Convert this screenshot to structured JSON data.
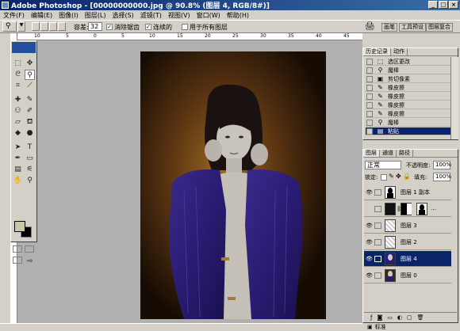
{
  "window": {
    "title": "Adobe Photoshop - [00000000000.jpg @ 90.8% (图层 4, RGB/8#)]"
  },
  "menu": [
    "文件(F)",
    "编辑(E)",
    "图像(I)",
    "图层(L)",
    "选择(S)",
    "滤镜(T)",
    "视图(V)",
    "窗口(W)",
    "帮助(H)"
  ],
  "options": {
    "tolerance_label": "容差:",
    "tolerance_value": "32",
    "antialias_label": "消除锯齿",
    "contiguous_label": "连续的",
    "all_layers_label": "用于所有图层"
  },
  "palette_well": [
    "画笔",
    "工具预设",
    "图层复合"
  ],
  "ruler_marks": [
    "10",
    "5",
    "0",
    "5",
    "10",
    "15",
    "20",
    "25",
    "30",
    "35",
    "40",
    "45"
  ],
  "history": {
    "tabs": [
      "历史记录",
      "动作"
    ],
    "items": [
      {
        "label": "选区更改",
        "icon": "selection-icon"
      },
      {
        "label": "魔棒",
        "icon": "magic-wand-icon"
      },
      {
        "label": "剪切像素",
        "icon": "cut-icon"
      },
      {
        "label": "橡皮擦",
        "icon": "eraser-icon"
      },
      {
        "label": "橡皮擦",
        "icon": "eraser-icon"
      },
      {
        "label": "橡皮擦",
        "icon": "eraser-icon"
      },
      {
        "label": "橡皮擦",
        "icon": "eraser-icon"
      },
      {
        "label": "魔棒",
        "icon": "magic-wand-icon"
      },
      {
        "label": "粘贴",
        "icon": "paste-icon",
        "selected": true
      }
    ]
  },
  "layers": {
    "tabs": [
      "图层",
      "通道",
      "路径"
    ],
    "blend_mode": "正常",
    "opacity_label": "不透明度:",
    "opacity_value": "100%",
    "lock_label": "锁定:",
    "fill_label": "填充:",
    "fill_value": "100%",
    "items": [
      {
        "name": "图层 1 副本",
        "visible": true
      },
      {
        "name": "",
        "visible": false,
        "has_mask": true,
        "more": "…"
      },
      {
        "name": "图层 3",
        "visible": true
      },
      {
        "name": "图层 2",
        "visible": true
      },
      {
        "name": "图层 4",
        "visible": true,
        "selected": true
      },
      {
        "name": "图层 0",
        "visible": true
      }
    ]
  },
  "status": {
    "label": "标准"
  }
}
